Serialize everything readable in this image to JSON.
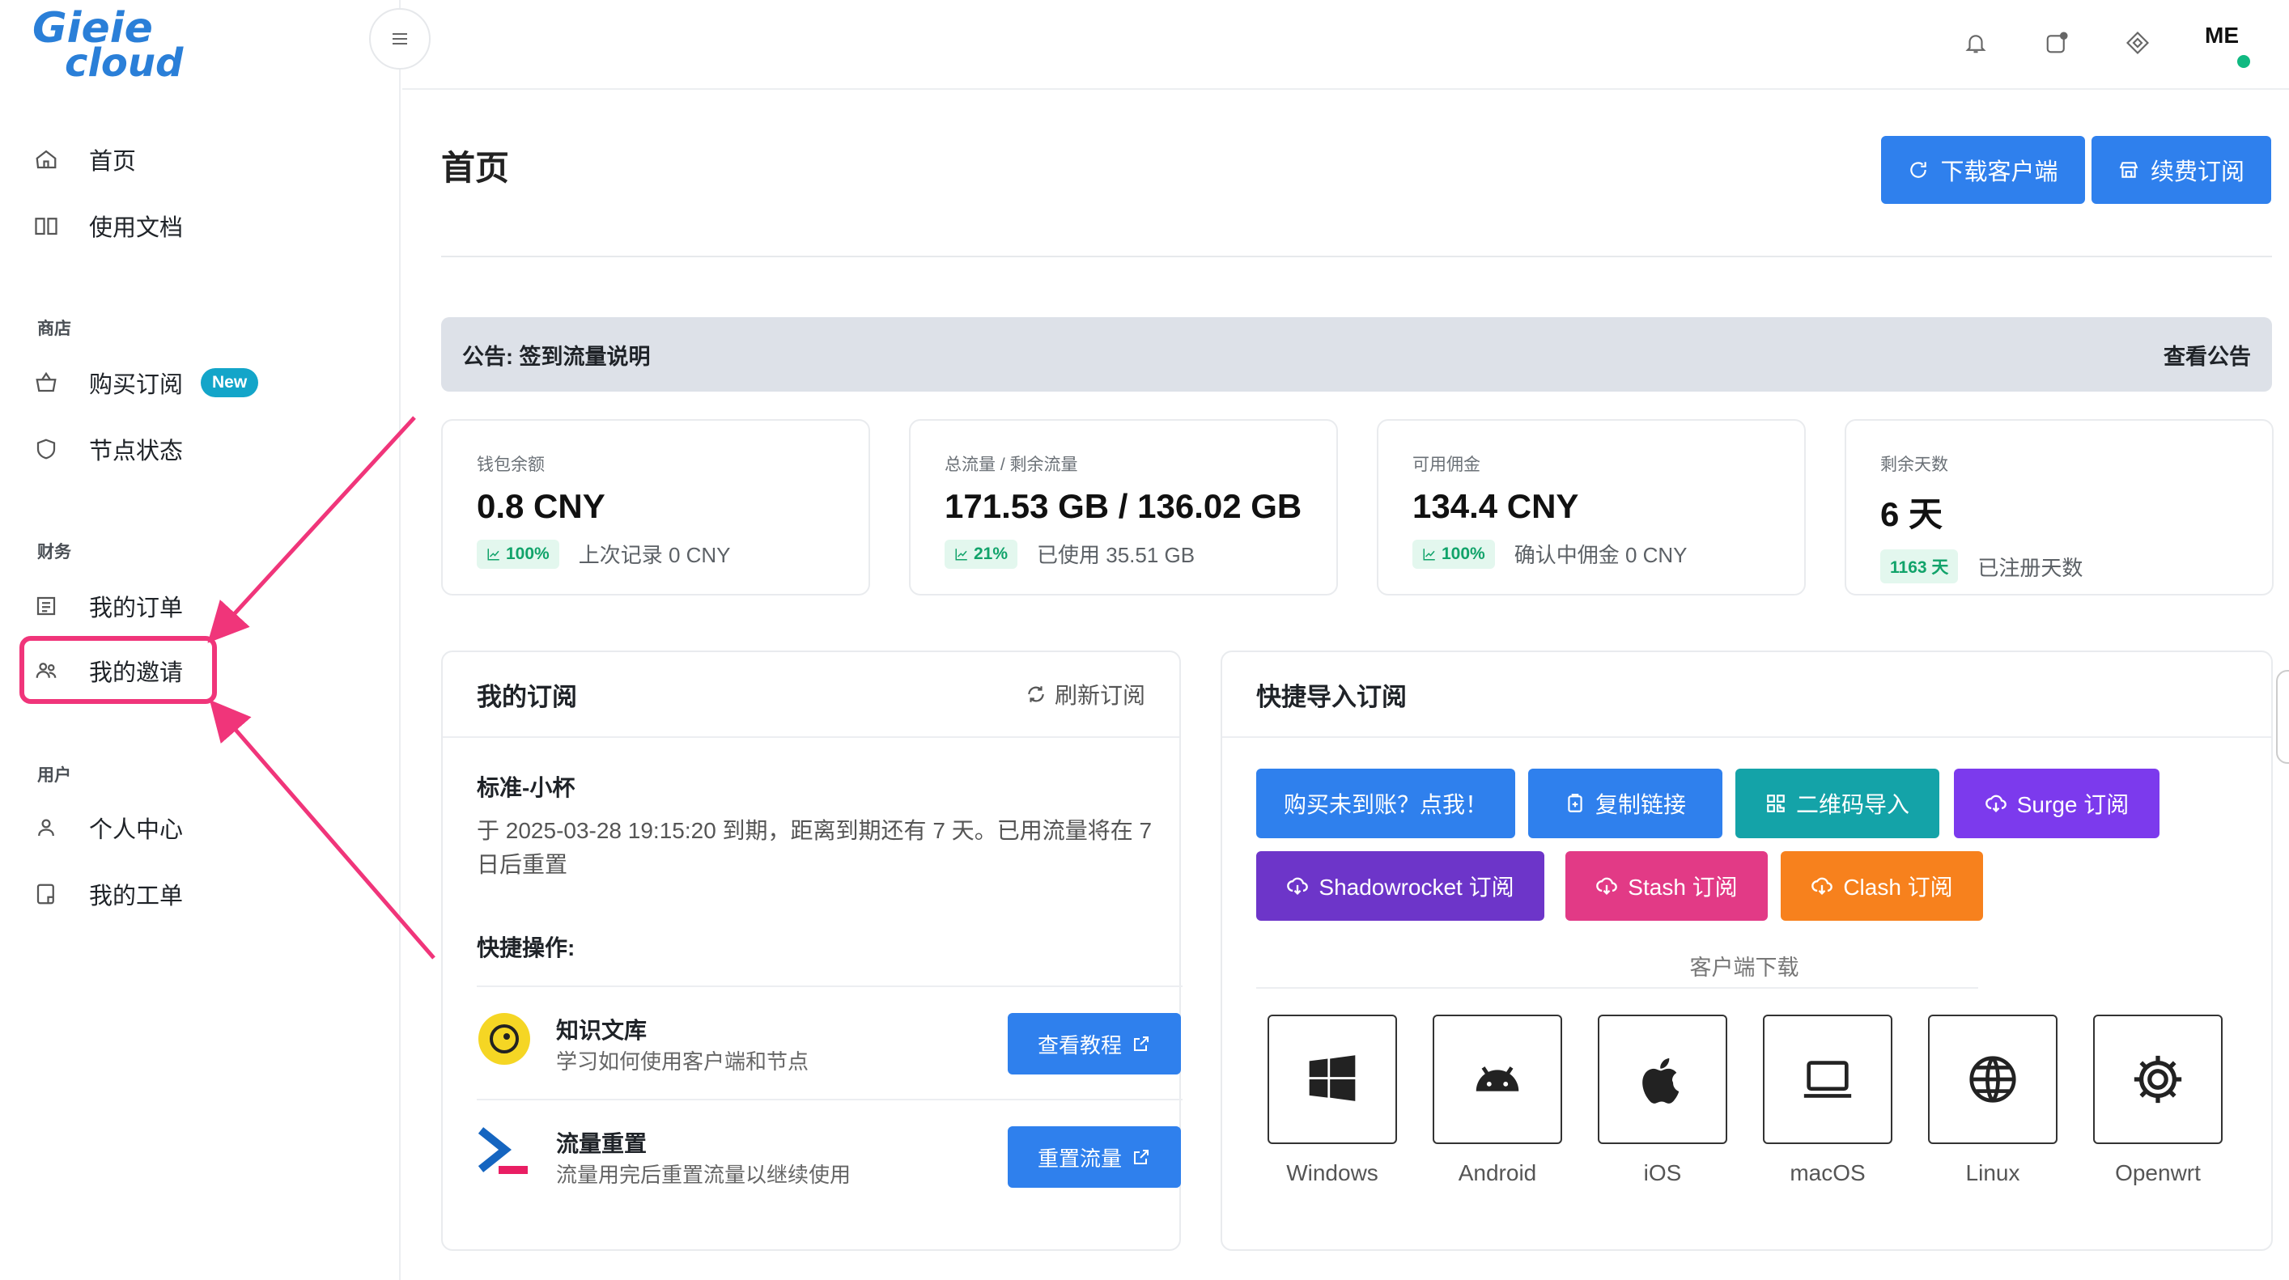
{
  "logo": {
    "line1": "Gieie",
    "line2": "cloud"
  },
  "sidebar": {
    "top_items": [
      {
        "label": "首页",
        "icon": "home-icon"
      },
      {
        "label": "使用文档",
        "icon": "book-icon"
      }
    ],
    "shop": {
      "label": "商店",
      "items": [
        {
          "label": "购买订阅",
          "icon": "basket-icon",
          "badge": "New"
        },
        {
          "label": "节点状态",
          "icon": "shield-icon"
        }
      ]
    },
    "finance": {
      "label": "财务",
      "items": [
        {
          "label": "我的订单",
          "icon": "receipt-icon"
        },
        {
          "label": "我的邀请",
          "icon": "users-icon"
        }
      ]
    },
    "user": {
      "label": "用户",
      "items": [
        {
          "label": "个人中心",
          "icon": "user-icon"
        },
        {
          "label": "我的工单",
          "icon": "ticket-icon"
        }
      ]
    }
  },
  "topbar": {
    "icons": [
      "bell-icon",
      "message-icon",
      "diamond-icon"
    ],
    "avatar": "ME",
    "status_color": "#10b981"
  },
  "header": {
    "title": "首页",
    "download_btn": "下载客户端",
    "renew_btn": "续费订阅"
  },
  "notice": {
    "text": "公告: 签到流量说明",
    "link": "查看公告"
  },
  "stats": [
    {
      "label": "钱包余额",
      "value": "0.8 CNY",
      "pill": "100%",
      "sub": "上次记录 0 CNY"
    },
    {
      "label": "总流量 / 剩余流量",
      "value": "171.53 GB / 136.02 GB",
      "pill": "21%",
      "sub": "已使用 35.51 GB"
    },
    {
      "label": "可用佣金",
      "value": "134.4 CNY",
      "pill": "100%",
      "sub": "确认中佣金 0 CNY"
    },
    {
      "label": "剩余天数",
      "value": "6 天",
      "pill": "1163 天",
      "sub": "已注册天数"
    }
  ],
  "subscription": {
    "title": "我的订阅",
    "refresh": "刷新订阅",
    "plan": "标准-小杯",
    "desc": "于 2025-03-28 19:15:20 到期，距离到期还有 7 天。已用流量将在 7 日后重置",
    "quick_title": "快捷操作:",
    "rows": [
      {
        "title": "知识文库",
        "desc": "学习如何使用客户端和节点",
        "btn": "查看教程"
      },
      {
        "title": "流量重置",
        "desc": "流量用完后重置流量以继续使用",
        "btn": "重置流量"
      }
    ]
  },
  "import": {
    "title": "快捷导入订阅",
    "buttons": [
      {
        "label": "购买未到账？点我！",
        "color": "#2f80ed"
      },
      {
        "label": "复制链接",
        "color": "#2f80ed"
      },
      {
        "label": "二维码导入",
        "color": "#14a3a8"
      },
      {
        "label": "Surge 订阅",
        "color": "#7c3aed"
      },
      {
        "label": "Shadowrocket 订阅",
        "color": "#6d35c9"
      },
      {
        "label": "Stash 订阅",
        "color": "#e23a86"
      },
      {
        "label": "Clash 订阅",
        "color": "#f7811d"
      }
    ],
    "download_label": "客户端下载",
    "clients": [
      "Windows",
      "Android",
      "iOS",
      "macOS",
      "Linux",
      "Openwrt"
    ]
  }
}
